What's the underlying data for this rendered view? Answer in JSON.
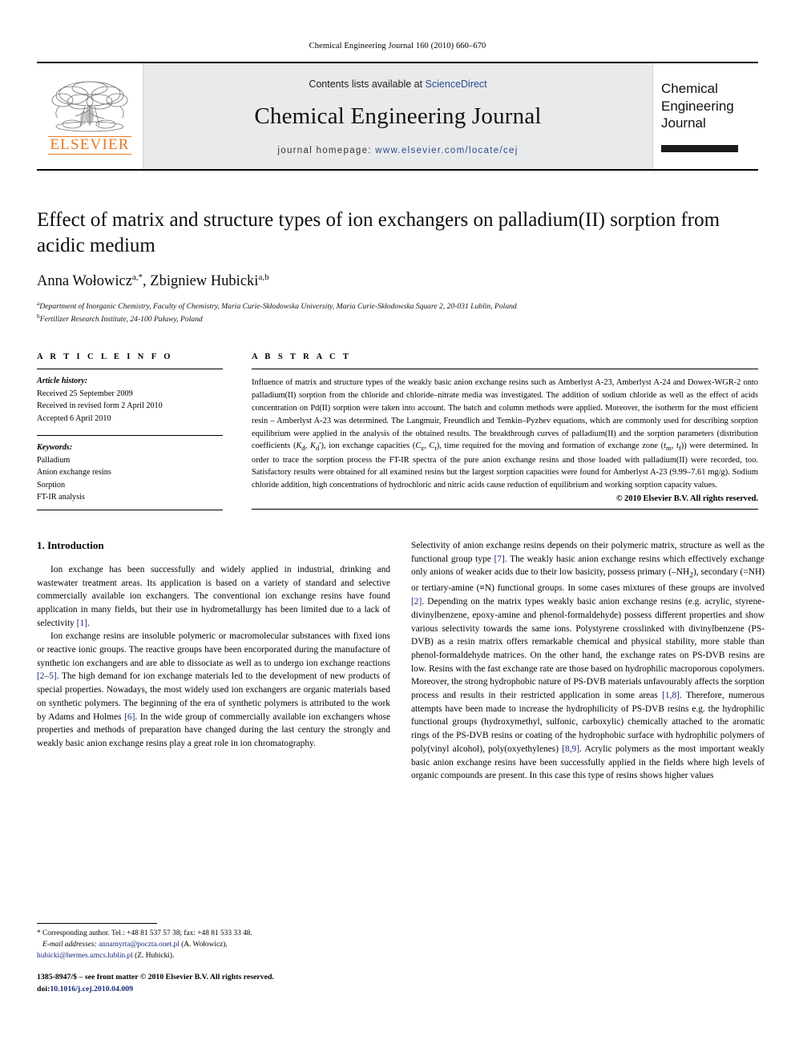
{
  "running_head": "Chemical Engineering Journal 160 (2010) 660–670",
  "masthead": {
    "publisher_name": "ELSEVIER",
    "contents_prefix": "Contents lists available at ",
    "contents_link": "ScienceDirect",
    "journal_name": "Chemical Engineering Journal",
    "homepage_label": "journal homepage:",
    "homepage_url": "www.elsevier.com/locate/cej",
    "cover_title": "Chemical Engineering Journal",
    "link_color": "#2a4b8d"
  },
  "article": {
    "title": "Effect of matrix and structure types of ion exchangers on palladium(II) sorption from acidic medium",
    "authors": "Anna Wołowicz",
    "authors_sup_1": "a,*",
    "authors_2": ", Zbigniew Hubicki",
    "authors_sup_2": "a,b",
    "affiliation_a_mark": "a",
    "affiliation_a": "Department of Inorganic Chemistry, Faculty of Chemistry, Maria Curie-Skłodowska University, Maria Curie-Skłodowska Square 2, 20-031 Lublin, Poland",
    "affiliation_b_mark": "b",
    "affiliation_b": "Fertilizer Research Institute, 24-100 Puławy, Poland"
  },
  "article_info": {
    "heading": "A R T I C L E    I N F O",
    "history_label": "Article history:",
    "history": [
      "Received 25 September 2009",
      "Received in revised form 2 April 2010",
      "Accepted 6 April 2010"
    ],
    "keywords_label": "Keywords:",
    "keywords": [
      "Palladium",
      "Anion exchange resins",
      "Sorption",
      "FT-IR analysis"
    ]
  },
  "abstract": {
    "heading": "A B S T R A C T",
    "text": "Influence of matrix and structure types of the weakly basic anion exchange resins such as Amberlyst A-23, Amberlyst A-24 and Dowex-WGR-2 onto palladium(II) sorption from the chloride and chloride–nitrate media was investigated. The addition of sodium chloride as well as the effect of acids concentration on Pd(II) sorption were taken into account. The batch and column methods were applied. Moreover, the isotherm for the most efficient resin – Amberlyst A-23 was determined. The Langmuir, Freundlich and Temkin–Pyzhev equations, which are commonly used for describing sorption equilibrium were applied in the analysis of the obtained results. The breakthrough curves of palladium(II) and the sorption parameters (distribution coefficients (Kd, K′d), ion exchange capacities (Cz, Ct), time required for the moving and formation of exchange zone (tm, tf)) were determined. In order to trace the sorption process the FT-IR spectra of the pure anion exchange resins and those loaded with palladium(II) were recorded, too. Satisfactory results were obtained for all examined resins but the largest sorption capacities were found for Amberlyst A-23 (9.99–7.61 mg/g). Sodium chloride addition, high concentrations of hydrochloric and nitric acids cause reduction of equilibrium and working sorption capacity values.",
    "copyright": "© 2010 Elsevier B.V. All rights reserved."
  },
  "body": {
    "section_heading": "1.  Introduction",
    "left_paragraphs": [
      "Ion exchange has been successfully and widely applied in industrial, drinking and wastewater treatment areas. Its application is based on a variety of standard and selective commercially available ion exchangers. The conventional ion exchange resins have found application in many fields, but their use in hydrometallurgy has been limited due to a lack of selectivity [1].",
      "Ion exchange resins are insoluble polymeric or macromolecular substances with fixed ions or reactive ionic groups. The reactive groups have been encorporated during the manufacture of synthetic ion exchangers and are able to dissociate as well as to undergo ion exchange reactions [2–5]. The high demand for ion exchange materials led to the development of new products of special properties. Nowadays, the most widely used ion exchangers are organic materials based on synthetic polymers. The beginning of the era of synthetic polymers is attributed to the work by Adams and Holmes [6]. In the wide group of commercially available ion exchangers whose properties and methods of preparation have changed during the last century the strongly and weakly basic anion exchange resins play a great role in ion chromatography."
    ],
    "right_paragraphs": [
      "Selectivity of anion exchange resins depends on their polymeric matrix, structure as well as the functional group type [7]. The weakly basic anion exchange resins which effectively exchange only anions of weaker acids due to their low basicity, possess primary (–NH2), secondary (=NH) or tertiary-amine (≡N) functional groups. In some cases mixtures of these groups are involved [2]. Depending on the matrix types weakly basic anion exchange resins (e.g. acrylic, styrene-divinylbenzene, epoxy-amine and phenol-formaldehyde) possess different properties and show various selectivity towards the same ions. Polystyrene crosslinked with divinylbenzene (PS-DVB) as a resin matrix offers remarkable chemical and physical stability, more stable than phenol-formaldehyde matrices. On the other hand, the exchange rates on PS-DVB resins are low. Resins with the fast exchange rate are those based on hydrophilic macroporous copolymers. Moreover, the strong hydrophobic nature of PS-DVB materials unfavourably affects the sorption process and results in their restricted application in some areas [1,8]. Therefore, numerous attempts have been made to increase the hydrophilicity of PS-DVB resins e.g. the hydrophilic functional groups (hydroxymethyl, sulfonic, carboxylic) chemically attached to the aromatic rings of the PS-DVB resins or coating of the hydrophobic surface with hydrophilic polymers of poly(vinyl alcohol), poly(oxyethylenes) [8,9]. Acrylic polymers as the most important weakly basic anion exchange resins have been successfully applied in the fields where high levels of organic compounds are present. In this case this type of resins shows higher values"
    ]
  },
  "footnote": {
    "corresponding": "* Corresponding author. Tel.: +48 81 537 57 38; fax: +48 81 533 33 48.",
    "email_label": "E-mail addresses:",
    "email_1": "annamyrta@poczta.onet.pl",
    "email_1_name": " (A. Wołowicz),",
    "email_2": "hubicki@hermes.umcs.lublin.pl",
    "email_2_name": " (Z. Hubicki)."
  },
  "imprint": {
    "line1": "1385-8947/$ – see front matter © 2010 Elsevier B.V. All rights reserved.",
    "doi_label": "doi:",
    "doi": "10.1016/j.cej.2010.04.009"
  }
}
